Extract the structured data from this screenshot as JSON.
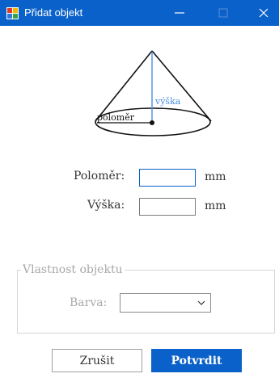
{
  "window": {
    "title": "Přidat objekt",
    "controls": {
      "minimize": "—",
      "maximize": "☐",
      "close": "✕"
    }
  },
  "diagram": {
    "height_label": "výška",
    "radius_label": "poloměr"
  },
  "form": {
    "radius_label": "Poloměr:",
    "radius_value": "",
    "radius_unit": "mm",
    "height_label": "Výška:",
    "height_value": "",
    "height_unit": "mm"
  },
  "properties": {
    "group_title": "Vlastnost objektu",
    "color_label": "Barva:",
    "color_value": ""
  },
  "buttons": {
    "cancel": "Zrušit",
    "confirm": "Potvrdit"
  },
  "colors": {
    "accent": "#0a61c9",
    "disabled_text": "#a8a8a8"
  }
}
